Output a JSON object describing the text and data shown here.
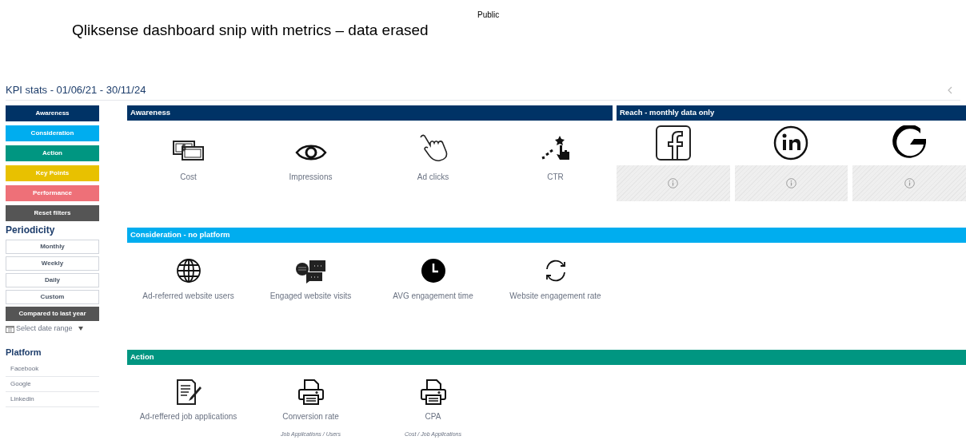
{
  "classification": "Public",
  "caption": "Qliksense dashboard snip with metrics – data erased",
  "sheet": {
    "title": "KPI stats - 01/06/21 - 30/11/24"
  },
  "sidebar": {
    "nav_buttons": [
      {
        "label": "Awareness",
        "color": "#003366"
      },
      {
        "label": "Consideration",
        "color": "#00adef"
      },
      {
        "label": "Action",
        "color": "#009681"
      },
      {
        "label": "Key Points",
        "color": "#e8c100"
      },
      {
        "label": "Performance",
        "color": "#ee7078"
      },
      {
        "label": "Reset filters",
        "color": "#555555"
      }
    ],
    "periodicity": {
      "title": "Periodicity",
      "buttons": [
        {
          "label": "Monthly",
          "kind": "outline"
        },
        {
          "label": "Weekly",
          "kind": "outline"
        },
        {
          "label": "Daily",
          "kind": "outline"
        },
        {
          "label": "Custom",
          "kind": "outline"
        },
        {
          "label": "Compared to last year",
          "kind": "filled"
        }
      ]
    },
    "date_range": {
      "placeholder": "Select date range"
    },
    "platform": {
      "title": "Platform",
      "items": [
        "Facebook",
        "Google",
        "Linkedin"
      ]
    }
  },
  "awareness": {
    "title": "Awareness",
    "metrics": [
      {
        "label": "Cost",
        "kind": "money"
      },
      {
        "label": "Impressions",
        "kind": "eye"
      },
      {
        "label": "Ad clicks",
        "kind": "hand"
      },
      {
        "label": "CTR",
        "kind": "click"
      }
    ]
  },
  "reach": {
    "title": "Reach - monthly data only",
    "platforms": [
      {
        "kind": "facebook"
      },
      {
        "kind": "linkedin"
      },
      {
        "kind": "google"
      }
    ]
  },
  "consideration": {
    "title": "Consideration - no platform",
    "metrics": [
      {
        "label": "Ad-referred website users",
        "kind": "globe"
      },
      {
        "label": "Engaged website visits",
        "kind": "chat"
      },
      {
        "label": "AVG engagement time",
        "kind": "clock"
      },
      {
        "label": "Website engagement rate",
        "kind": "refresh"
      }
    ]
  },
  "action": {
    "title": "Action",
    "metrics": [
      {
        "label": "Ad-reffered job applications",
        "kind": "document"
      },
      {
        "label": "Conversion rate",
        "kind": "printer",
        "subtitle": "Job Applications / Users"
      },
      {
        "label": "CPA",
        "kind": "printer",
        "subtitle": "Cost / Job Applications"
      }
    ]
  }
}
